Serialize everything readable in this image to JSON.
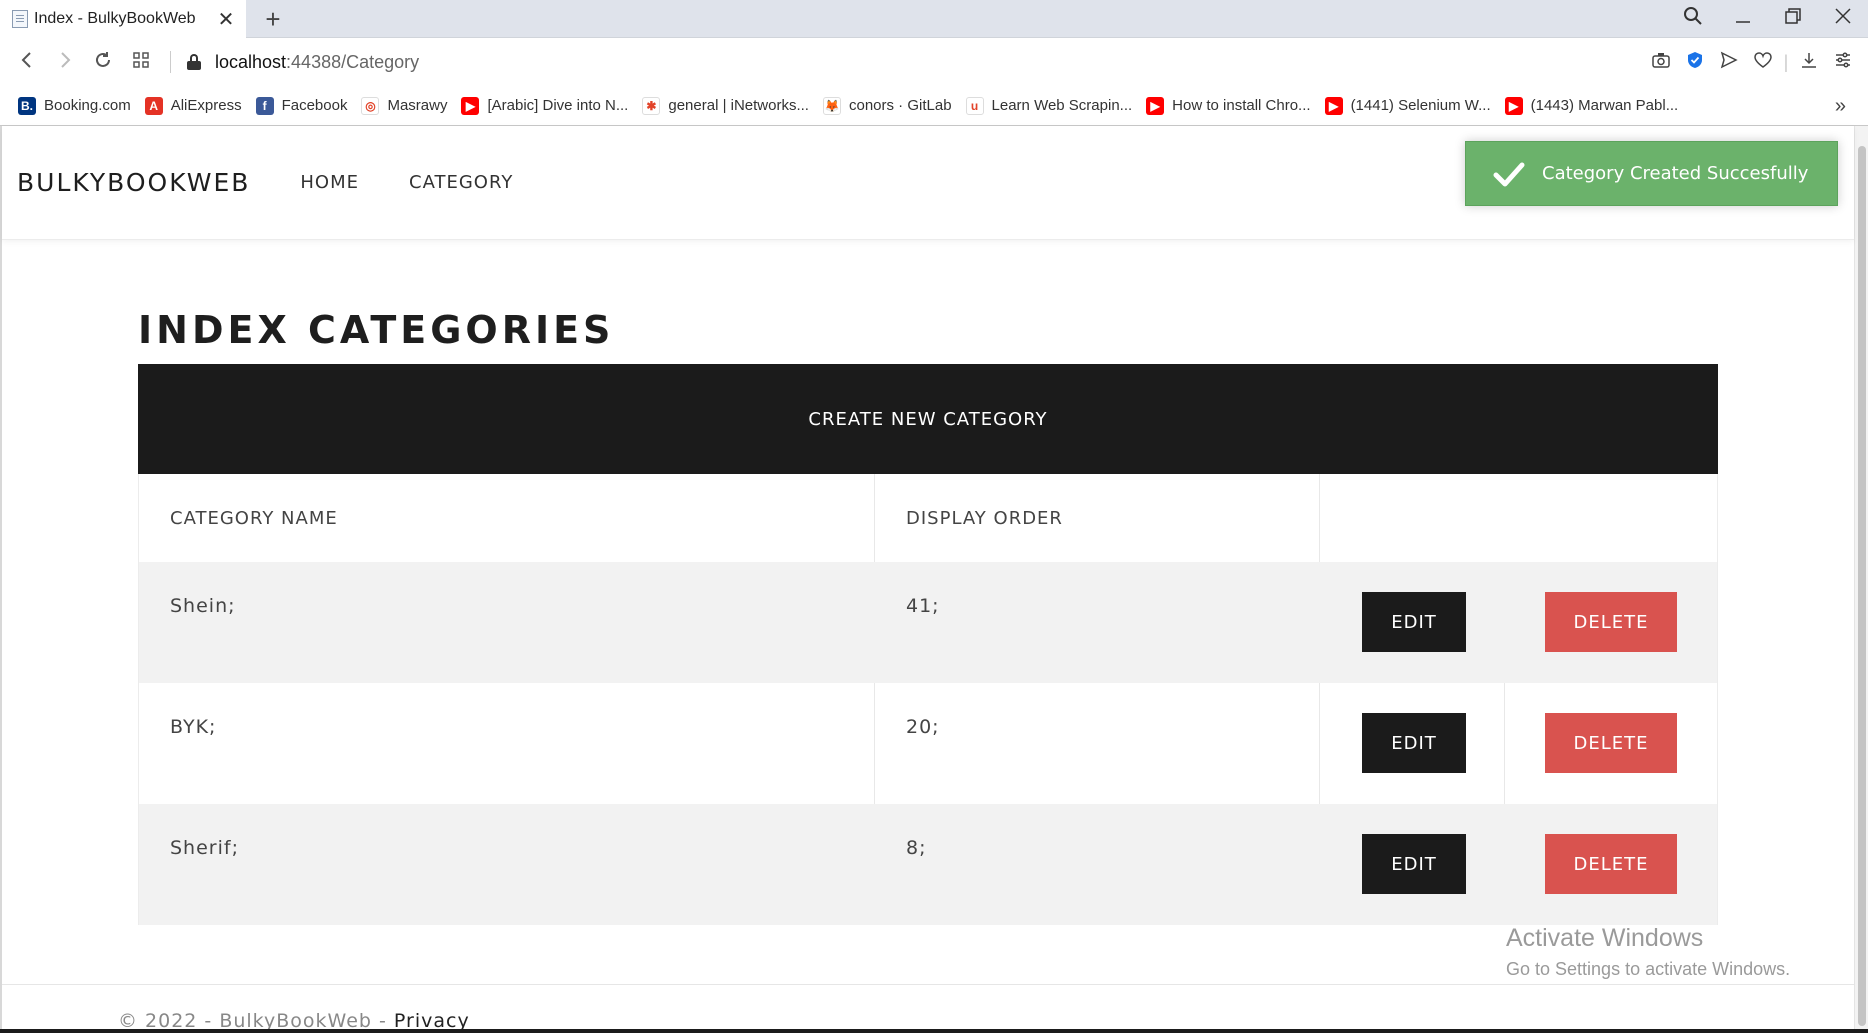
{
  "browser": {
    "tab_title": "Index - BulkyBookWeb",
    "tab_close": "✕",
    "new_tab": "+",
    "url_host": "localhost",
    "url_path": ":44388/Category",
    "bookmarks": [
      {
        "label": "Booking.com",
        "icon": "booking-icon",
        "color": "#003580",
        "glyph": "B."
      },
      {
        "label": "AliExpress",
        "icon": "aliexpress-icon",
        "color": "#e43225",
        "glyph": "A"
      },
      {
        "label": "Facebook",
        "icon": "facebook-icon",
        "color": "#3b5998",
        "glyph": "f"
      },
      {
        "label": "Masrawy",
        "icon": "masrawy-icon",
        "color": "#ffffff",
        "glyph": "◎"
      },
      {
        "label": "[Arabic] Dive into N...",
        "icon": "youtube-icon",
        "color": "#ff0000",
        "glyph": "▶"
      },
      {
        "label": "general | iNetworks...",
        "icon": "slack-icon",
        "color": "#ffffff",
        "glyph": "✱"
      },
      {
        "label": "conors · GitLab",
        "icon": "gitlab-icon",
        "color": "#ffffff",
        "glyph": "🦊"
      },
      {
        "label": "Learn Web Scrapin...",
        "icon": "udemy-icon",
        "color": "#ffffff",
        "glyph": "u"
      },
      {
        "label": "How to install Chro...",
        "icon": "youtube-icon",
        "color": "#ff0000",
        "glyph": "▶"
      },
      {
        "label": "(1441) Selenium W...",
        "icon": "youtube-icon",
        "color": "#ff0000",
        "glyph": "▶"
      },
      {
        "label": "(1443) Marwan Pabl...",
        "icon": "youtube-icon",
        "color": "#ff0000",
        "glyph": "▶"
      }
    ],
    "more": "»"
  },
  "navbar": {
    "brand": "BULKYBOOKWEB",
    "links": [
      "HOME",
      "CATEGORY"
    ]
  },
  "toast": {
    "message": "Category Created Succesfully",
    "color": "#6bb26b"
  },
  "main": {
    "heading": "INDEX CATEGORIES",
    "create_button": "CREATE NEW CATEGORY",
    "table": {
      "columns": [
        "CATEGORY NAME",
        "DISPLAY ORDER"
      ],
      "rows": [
        {
          "name": "Shein;",
          "order": "41;"
        },
        {
          "name": "BYK;",
          "order": "20;"
        },
        {
          "name": "Sherif;",
          "order": "8;"
        }
      ],
      "edit_label": "EDIT",
      "delete_label": "DELETE"
    }
  },
  "watermark": {
    "title": "Activate Windows",
    "subtitle": "Go to Settings to activate Windows."
  },
  "footer": {
    "text": "© 2022 - BulkyBookWeb - ",
    "privacy": "Privacy"
  },
  "colors": {
    "dark": "#1b1b1b",
    "danger": "#d9534f",
    "success": "#6bb26b"
  }
}
